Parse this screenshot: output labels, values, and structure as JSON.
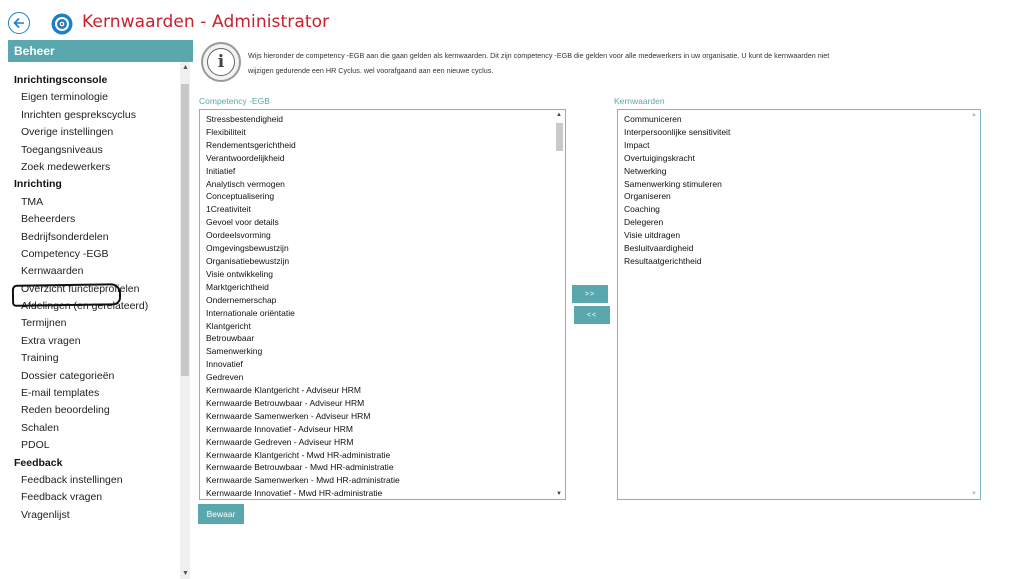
{
  "window": {
    "title": "Kernwaarden - Administrator",
    "back_icon": "back-arrow-icon",
    "app_icon": "app-logo-icon"
  },
  "sidebar": {
    "header": "Beheer",
    "groups": [
      {
        "title": "Inrichtingsconsole",
        "items": [
          "Eigen terminologie",
          "Inrichten gesprekscyclus",
          "Overige instellingen",
          "Toegangsniveaus",
          "Zoek medewerkers"
        ]
      },
      {
        "title": "Inrichting",
        "items": [
          "TMA",
          "Beheerders",
          "Bedrijfsonderdelen",
          "Competency -EGB",
          "Kernwaarden",
          "Overzicht functieprofielen",
          "Afdelingen (en gerelateerd)",
          "Termijnen",
          "Extra vragen",
          "Training",
          "Dossier categorieën",
          "E-mail templates",
          "Reden beoordeling",
          "Schalen",
          "PDOL"
        ]
      },
      {
        "title": "Feedback",
        "items": [
          "Feedback instellingen",
          "Feedback vragen",
          "Vragenlijst"
        ]
      }
    ],
    "selected": "Kernwaarden"
  },
  "info": {
    "icon": "info-icon",
    "line1": "Wijs hieronder de competency -EGB aan die gaan gelden als kernwaarden. Dit zijn competency -EGB die gelden voor alle medewerkers in uw organisatie. U kunt de kernwaarden niet",
    "line2": "wijzigen gedurende een HR Cyclus. wel voorafgaand aan een nieuwe cyclus."
  },
  "left_list": {
    "label": "Competency -EGB",
    "items": [
      "Stressbestendigheid",
      "Flexibiliteit",
      "Rendementsgerichtheid",
      "Verantwoordelijkheid",
      "Initiatief",
      "Analytisch vermogen",
      "Conceptualisering",
      "1Creativiteit",
      "Gevoel voor details",
      "Oordeelsvorming",
      "Omgevingsbewustzijn",
      "Organisatiebewustzijn",
      "Visie ontwikkeling",
      "Marktgerichtheid",
      "Ondernemerschap",
      "Internationale oriëntatie",
      "Klantgericht",
      "Betrouwbaar",
      "Samenwerking",
      "Innovatief",
      "Gedreven",
      "Kernwaarde Klantgericht - Adviseur HRM",
      "Kernwaarde Betrouwbaar - Adviseur HRM",
      "Kernwaarde Samenwerken - Adviseur HRM",
      "Kernwaarde Innovatief - Adviseur HRM",
      "Kernwaarde Gedreven - Adviseur HRM",
      "Kernwaarde Klantgericht - Mwd HR-administratie",
      "Kernwaarde Betrouwbaar - Mwd HR-administratie",
      "Kernwaarde Samenwerken - Mwd HR-administratie",
      "Kernwaarde Innovatief - Mwd HR-administratie"
    ]
  },
  "right_list": {
    "label": "Kernwaarden",
    "items": [
      "Communiceren",
      "Interpersoonlijke sensitiviteit",
      "Impact",
      "Overtuigingskracht",
      "Netwerking",
      "Samenwerking stimuleren",
      "Organiseren",
      "Coaching",
      "Delegeren",
      "Visie uitdragen",
      "Besluitvaardigheid",
      "Resultaatgerichtheid"
    ]
  },
  "buttons": {
    "add": ">>",
    "remove": "<<",
    "save": "Bewaar"
  },
  "colors": {
    "accent": "#5aa7ad",
    "title_red": "#c8202c",
    "back_blue": "#1e7fc2"
  }
}
